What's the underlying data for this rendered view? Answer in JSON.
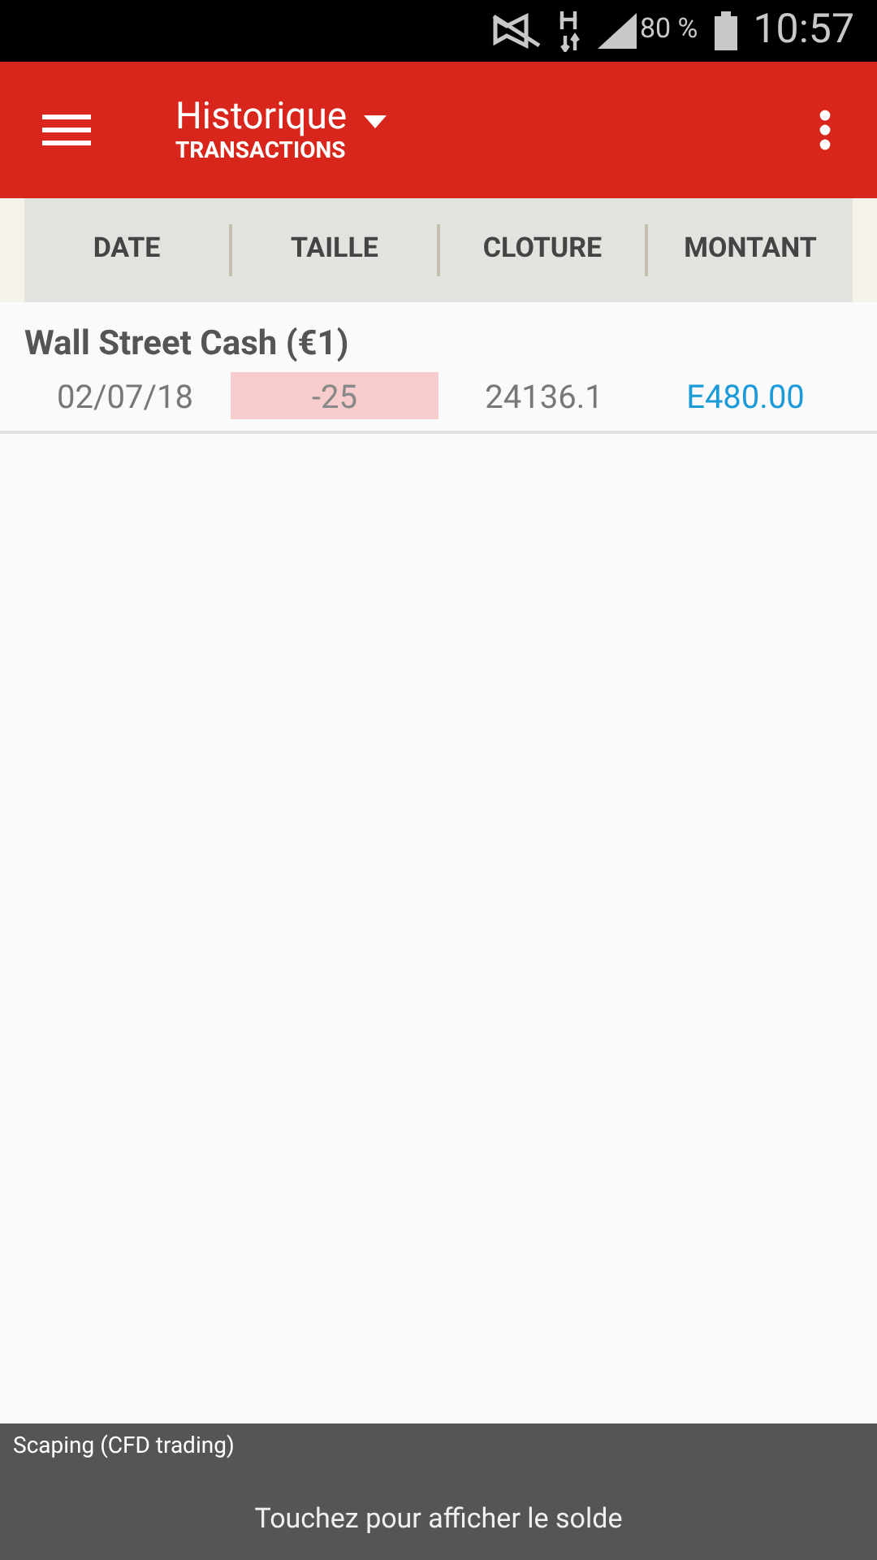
{
  "status_bar": {
    "battery": "80 %",
    "time": "10:57"
  },
  "app_bar": {
    "title": "Historique",
    "subtitle": "TRANSACTIONS"
  },
  "table": {
    "columns": [
      "DATE",
      "TAILLE",
      "CLOTURE",
      "MONTANT"
    ],
    "rows": [
      {
        "name": "Wall Street Cash (€1)",
        "date": "02/07/18",
        "size": "-25",
        "size_negative": true,
        "close": "24136.1",
        "amount": "E480.00"
      }
    ]
  },
  "footer": {
    "account": "Scaping (CFD trading)",
    "action": "Touchez pour afficher le solde"
  }
}
